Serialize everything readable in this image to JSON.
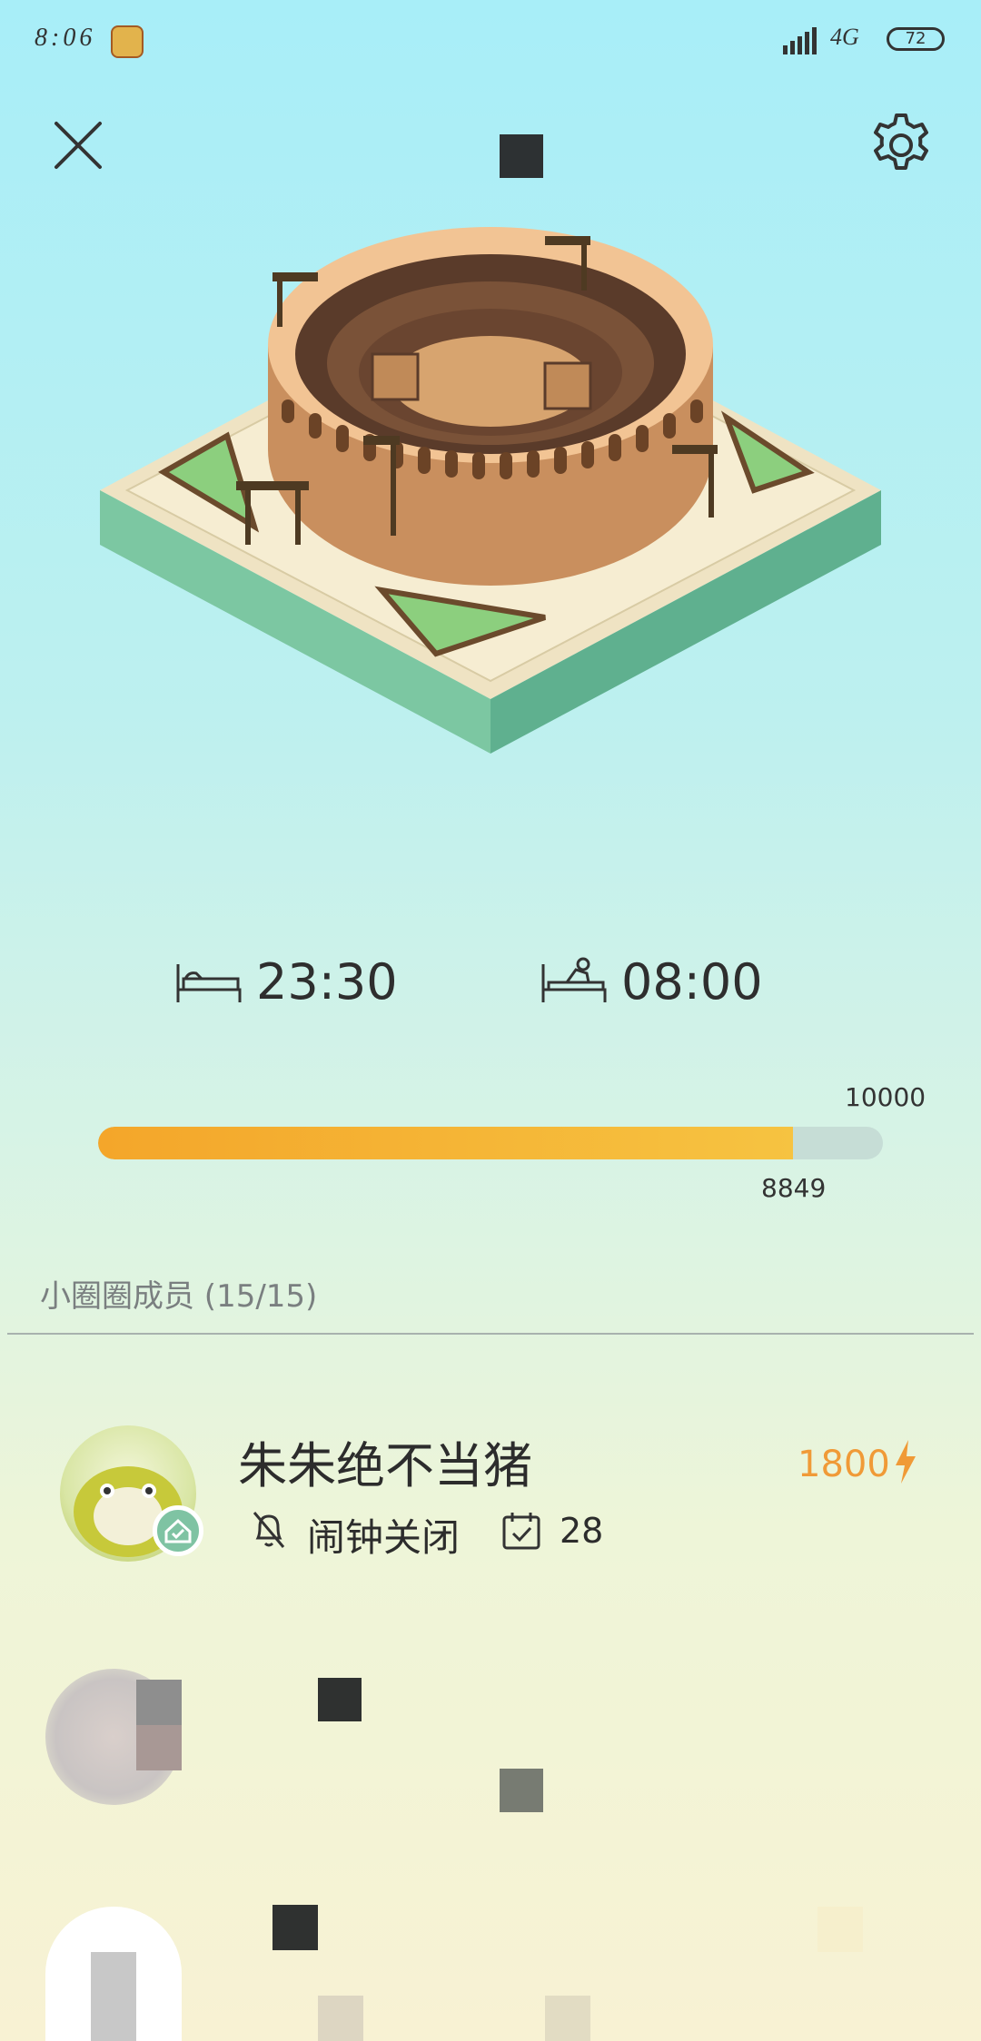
{
  "status_bar": {
    "time": "8:06",
    "network": "4G",
    "battery": "72"
  },
  "header": {
    "close_icon": "close-icon",
    "settings_icon": "gear-icon"
  },
  "schedule": {
    "sleep_time": "23:30",
    "wake_time": "08:00"
  },
  "progress": {
    "max_label": "10000",
    "current_label": "8849",
    "fraction": 0.8849,
    "fill_color": "#f4a62a",
    "track_color": "#c6ddd6"
  },
  "members": {
    "section_title": "小圈圈成员 (15/15)",
    "items": [
      {
        "name": "朱朱绝不当猪",
        "alarm_status": "闹钟关闭",
        "days": "28",
        "energy": "1800"
      }
    ]
  },
  "colors": {
    "accent_orange": "#f09a37",
    "badge_green": "#7fc3a3"
  }
}
